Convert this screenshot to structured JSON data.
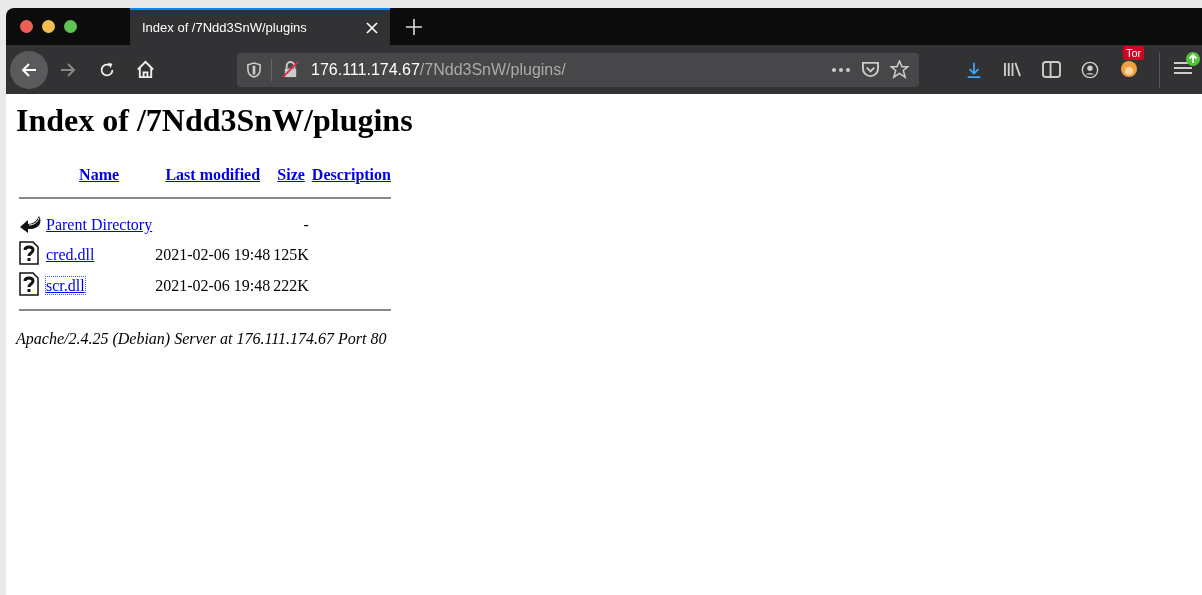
{
  "tab": {
    "title": "Index of /7Ndd3SnW/plugins",
    "selected": true
  },
  "address": {
    "host": "176.111.174.67",
    "path": "/7Ndd3SnW/plugins/"
  },
  "toolbar": {
    "badge": "Tor"
  },
  "page": {
    "heading": "Index of /7Ndd3SnW/plugins",
    "columns": [
      "Name",
      "Last modified",
      "Size",
      "Description"
    ],
    "rows": [
      {
        "kind": "parent",
        "name": "Parent Directory",
        "modified": "",
        "size": "-",
        "focused": false
      },
      {
        "kind": "file",
        "name": "cred.dll",
        "modified": "2021-02-06 19:48",
        "size": "125K",
        "focused": false
      },
      {
        "kind": "file",
        "name": "scr.dll",
        "modified": "2021-02-06 19:48",
        "size": "222K",
        "focused": true
      }
    ],
    "footer": "Apache/2.4.25 (Debian) Server at 176.111.174.67 Port 80"
  }
}
